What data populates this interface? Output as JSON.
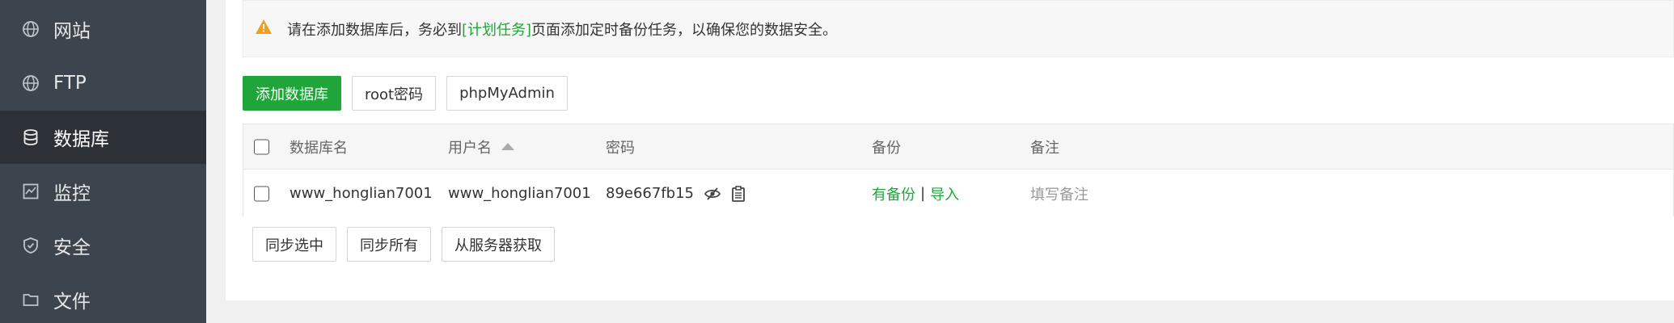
{
  "sidebar": {
    "items": [
      {
        "label": "网站",
        "icon": "globe-icon"
      },
      {
        "label": "FTP",
        "icon": "ftp-globe-icon"
      },
      {
        "label": "数据库",
        "icon": "database-icon",
        "active": true
      },
      {
        "label": "监控",
        "icon": "monitor-icon"
      },
      {
        "label": "安全",
        "icon": "shield-icon"
      },
      {
        "label": "文件",
        "icon": "folder-icon"
      }
    ]
  },
  "alert": {
    "text_before": "请在添加数据库后，务必到",
    "link": "[计划任务]",
    "text_after": "页面添加定时备份任务，以确保您的数据安全。"
  },
  "toolbar": {
    "add_db": "添加数据库",
    "root_password": "root密码",
    "phpmyadmin": "phpMyAdmin"
  },
  "table": {
    "headers": {
      "name": "数据库名",
      "username": "用户名",
      "password": "密码",
      "backup": "备份",
      "note": "备注"
    },
    "rows": [
      {
        "name": "www_honglian7001",
        "username": "www_honglian7001",
        "password": "89e667fb15",
        "backup_status": "有备份",
        "backup_sep": "|",
        "import": "导入",
        "note_placeholder": "填写备注"
      }
    ]
  },
  "bottom_buttons": {
    "sync_selected": "同步选中",
    "sync_all": "同步所有",
    "fetch_from_server": "从服务器获取"
  },
  "colors": {
    "sidebar_bg": "#3c444d",
    "sidebar_active": "#2c3138",
    "accent_green": "#20a53a",
    "warning_orange": "#f0a020"
  }
}
